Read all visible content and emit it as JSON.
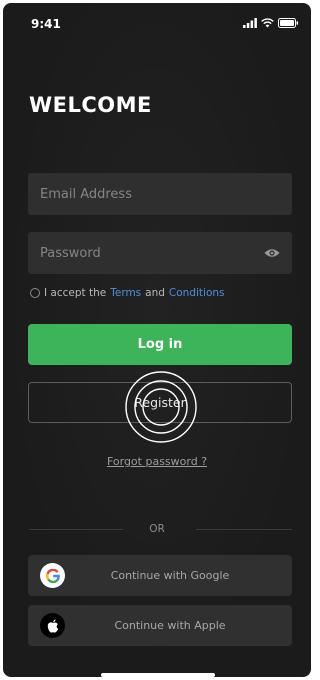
{
  "status_bar": {
    "time": "9:41"
  },
  "title": "WELCOME",
  "form": {
    "email_placeholder": "Email Address",
    "password_placeholder": "Password"
  },
  "terms": {
    "prefix": "I accept the",
    "terms_link": "Terms",
    "middle": "and",
    "conditions_link": "Conditions"
  },
  "buttons": {
    "login": "Log in",
    "register": "Register",
    "forgot_password": "Forgot password ?"
  },
  "divider": {
    "label": "OR"
  },
  "social": {
    "google": "Continue with Google",
    "apple": "Continue with Apple"
  },
  "icons": {
    "password_toggle": "eye-icon",
    "google": "google-icon",
    "apple": "apple-icon"
  },
  "colors": {
    "background": "#1b1b1b",
    "field": "#2f2f2f",
    "primary": "#3db35a",
    "link": "#4d8fe0"
  }
}
